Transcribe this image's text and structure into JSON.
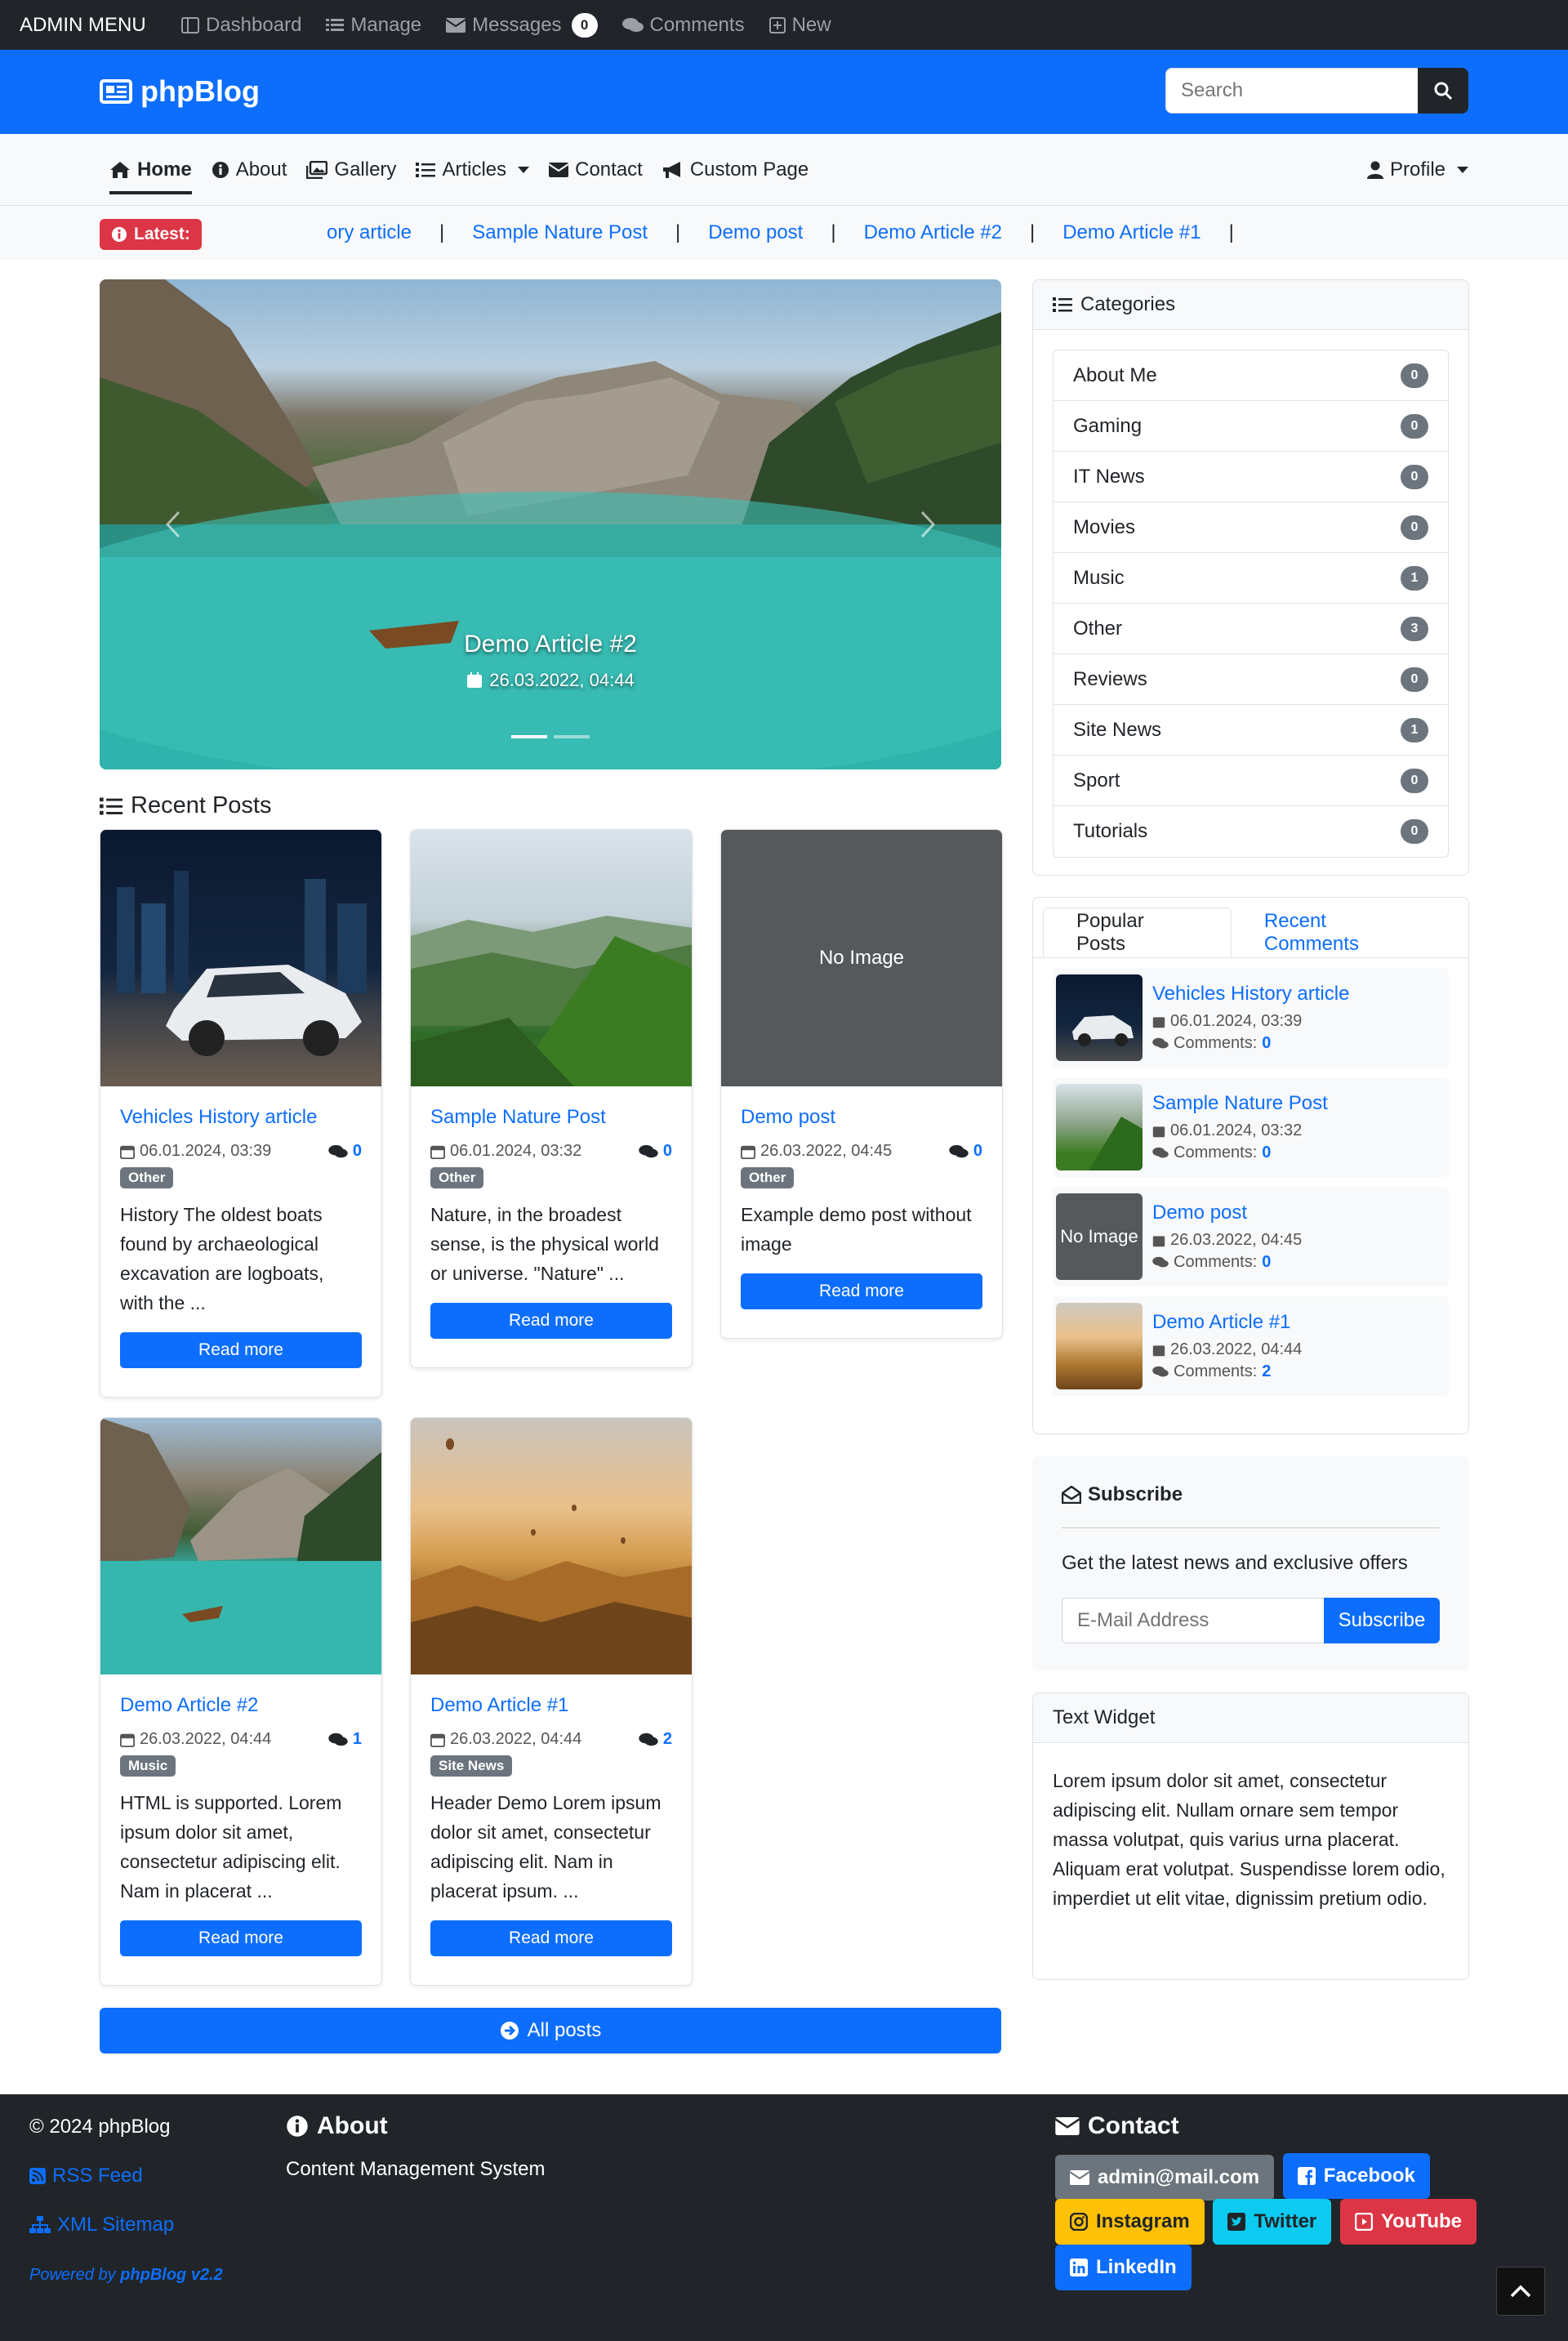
{
  "adminbar": {
    "brand": "ADMIN MENU",
    "items": [
      {
        "icon": "dashboard-icon",
        "label": "Dashboard"
      },
      {
        "icon": "manage-list-icon",
        "label": "Manage"
      },
      {
        "icon": "envelope-icon",
        "label": "Messages",
        "count": "0"
      },
      {
        "icon": "comments-icon",
        "label": "Comments"
      },
      {
        "icon": "plus-square-icon",
        "label": "New"
      }
    ]
  },
  "header": {
    "logo": "phpBlog",
    "search_placeholder": "Search"
  },
  "nav": {
    "items": [
      "Home",
      "About",
      "Gallery",
      "Articles",
      "Contact",
      "Custom Page"
    ],
    "profile": "Profile"
  },
  "latest": {
    "label": "Latest:",
    "items": [
      "ory article",
      "Sample Nature Post",
      "Demo post",
      "Demo Article #2",
      "Demo Article #1"
    ]
  },
  "hero": {
    "title": "Demo Article #2",
    "date": "26.03.2022, 04:44"
  },
  "recent": {
    "heading": "Recent Posts",
    "read_more": "Read more",
    "no_image": "No Image",
    "posts": [
      {
        "title": "Vehicles History article",
        "date": "06.01.2024, 03:39",
        "comments": "0",
        "category": "Other",
        "excerpt": "History The oldest boats found by archaeological excavation are logboats, with the ..."
      },
      {
        "title": "Sample Nature Post",
        "date": "06.01.2024, 03:32",
        "comments": "0",
        "category": "Other",
        "excerpt": "Nature, in the broadest sense, is the physical world or universe. \"Nature\" ..."
      },
      {
        "title": "Demo post",
        "date": "26.03.2022, 04:45",
        "comments": "0",
        "category": "Other",
        "excerpt": "Example demo post without image"
      },
      {
        "title": "Demo Article #2",
        "date": "26.03.2022, 04:44",
        "comments": "1",
        "category": "Music",
        "excerpt": "HTML is supported. Lorem ipsum dolor sit amet, consectetur adipiscing elit. Nam in placerat ..."
      },
      {
        "title": "Demo Article #1",
        "date": "26.03.2022, 04:44",
        "comments": "2",
        "category": "Site News",
        "excerpt": "Header Demo Lorem ipsum dolor sit amet, consectetur adipiscing elit. Nam in placerat ipsum. ..."
      }
    ],
    "all_posts": "All posts"
  },
  "categories": {
    "heading": "Categories",
    "items": [
      {
        "name": "About Me",
        "count": "0"
      },
      {
        "name": "Gaming",
        "count": "0"
      },
      {
        "name": "IT News",
        "count": "0"
      },
      {
        "name": "Movies",
        "count": "0"
      },
      {
        "name": "Music",
        "count": "1"
      },
      {
        "name": "Other",
        "count": "3"
      },
      {
        "name": "Reviews",
        "count": "0"
      },
      {
        "name": "Site News",
        "count": "1"
      },
      {
        "name": "Sport",
        "count": "0"
      },
      {
        "name": "Tutorials",
        "count": "0"
      }
    ]
  },
  "popular": {
    "tabs": [
      "Popular Posts",
      "Recent Comments"
    ],
    "comments_label": "Comments:",
    "no_image": "No Image",
    "items": [
      {
        "title": "Vehicles History article",
        "date": "06.01.2024, 03:39",
        "comments": "0"
      },
      {
        "title": "Sample Nature Post",
        "date": "06.01.2024, 03:32",
        "comments": "0"
      },
      {
        "title": "Demo post",
        "date": "26.03.2022, 04:45",
        "comments": "0"
      },
      {
        "title": "Demo Article #1",
        "date": "26.03.2022, 04:44",
        "comments": "2"
      }
    ]
  },
  "subscribe": {
    "heading": "Subscribe",
    "text": "Get the latest news and exclusive offers",
    "placeholder": "E-Mail Address",
    "button": "Subscribe"
  },
  "text_widget": {
    "heading": "Text Widget",
    "body": "Lorem ipsum dolor sit amet, consectetur adipiscing elit. Nullam ornare sem tempor massa volutpat, quis varius urna placerat. Aliquam erat volutpat. Suspendisse lorem odio, imperdiet ut elit vitae, dignissim pretium odio."
  },
  "footer": {
    "copyright": "© 2024 phpBlog",
    "rss": "RSS Feed",
    "sitemap": "XML Sitemap",
    "powered_prefix": "Powered by",
    "powered_name": "phpBlog v2.2",
    "about_heading": "About",
    "about_text": "Content Management System",
    "contact_heading": "Contact",
    "contacts": [
      {
        "label": "admin@mail.com",
        "color": "#6c757d"
      },
      {
        "label": "Facebook",
        "color": "#0d6efd"
      },
      {
        "label": "Instagram",
        "color": "#ffc107"
      },
      {
        "label": "Twitter",
        "color": "#0dcaf0"
      },
      {
        "label": "YouTube",
        "color": "#dc3545"
      },
      {
        "label": "LinkedIn",
        "color": "#0d6efd"
      }
    ]
  },
  "colors": {
    "primary": "#0d6efd",
    "dark": "#212529",
    "danger": "#dc3545"
  }
}
